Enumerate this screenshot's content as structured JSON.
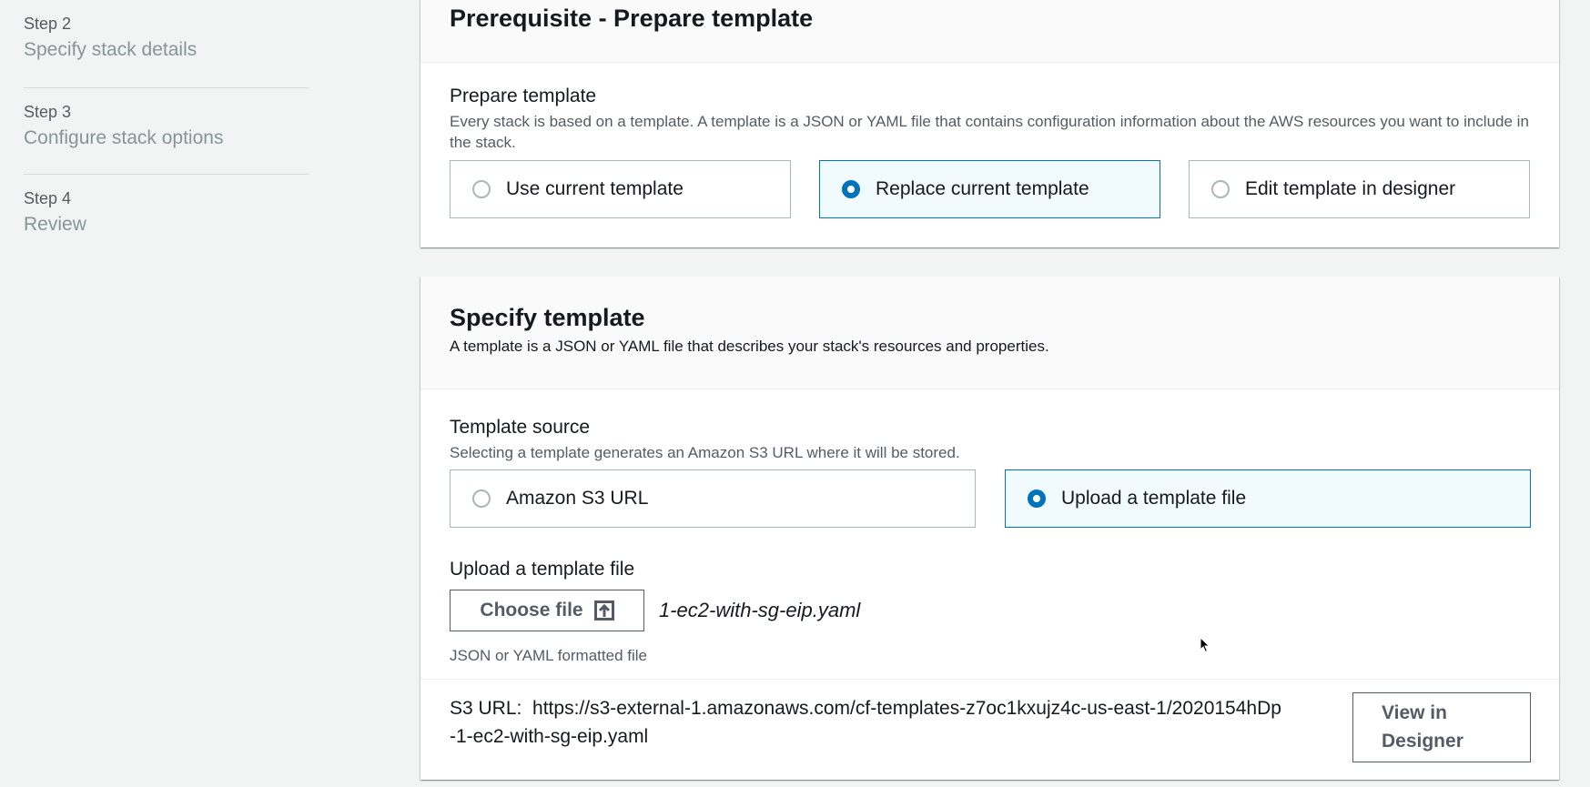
{
  "sidebar": {
    "steps": [
      {
        "number": "Step 2",
        "title": "Specify stack details"
      },
      {
        "number": "Step 3",
        "title": "Configure stack options"
      },
      {
        "number": "Step 4",
        "title": "Review"
      }
    ]
  },
  "prerequisite": {
    "title": "Prerequisite - Prepare template",
    "field_label": "Prepare template",
    "field_desc": "Every stack is based on a template. A template is a JSON or YAML file that contains configuration information about the AWS resources you want to include in the stack.",
    "options": [
      {
        "label": "Use current template",
        "selected": false
      },
      {
        "label": "Replace current template",
        "selected": true
      },
      {
        "label": "Edit template in designer",
        "selected": false
      }
    ]
  },
  "specify": {
    "title": "Specify template",
    "desc": "A template is a JSON or YAML file that describes your stack's resources and properties.",
    "source_label": "Template source",
    "source_desc": "Selecting a template generates an Amazon S3 URL where it will be stored.",
    "source_options": [
      {
        "label": "Amazon S3 URL",
        "selected": false
      },
      {
        "label": "Upload a template file",
        "selected": true
      }
    ],
    "upload_label": "Upload a template file",
    "choose_file_label": "Choose file",
    "file_name": "1-ec2-with-sg-eip.yaml",
    "file_hint": "JSON or YAML formatted file",
    "s3_label": "S3 URL:",
    "s3_url_line1": "https://s3-external-1.amazonaws.com/cf-templates-z7oc1kxujz4c-us-east-1/2020154hDp",
    "s3_url_line2": "-1-ec2-with-sg-eip.yaml",
    "view_designer_line1": "View in",
    "view_designer_line2": "Designer"
  },
  "colors": {
    "accent": "#0073bb",
    "selected_bg": "#f1faff",
    "page_bg": "#f2f3f3"
  },
  "icons": {
    "upload": "upload-icon",
    "cursor": "mouse-cursor-icon"
  }
}
